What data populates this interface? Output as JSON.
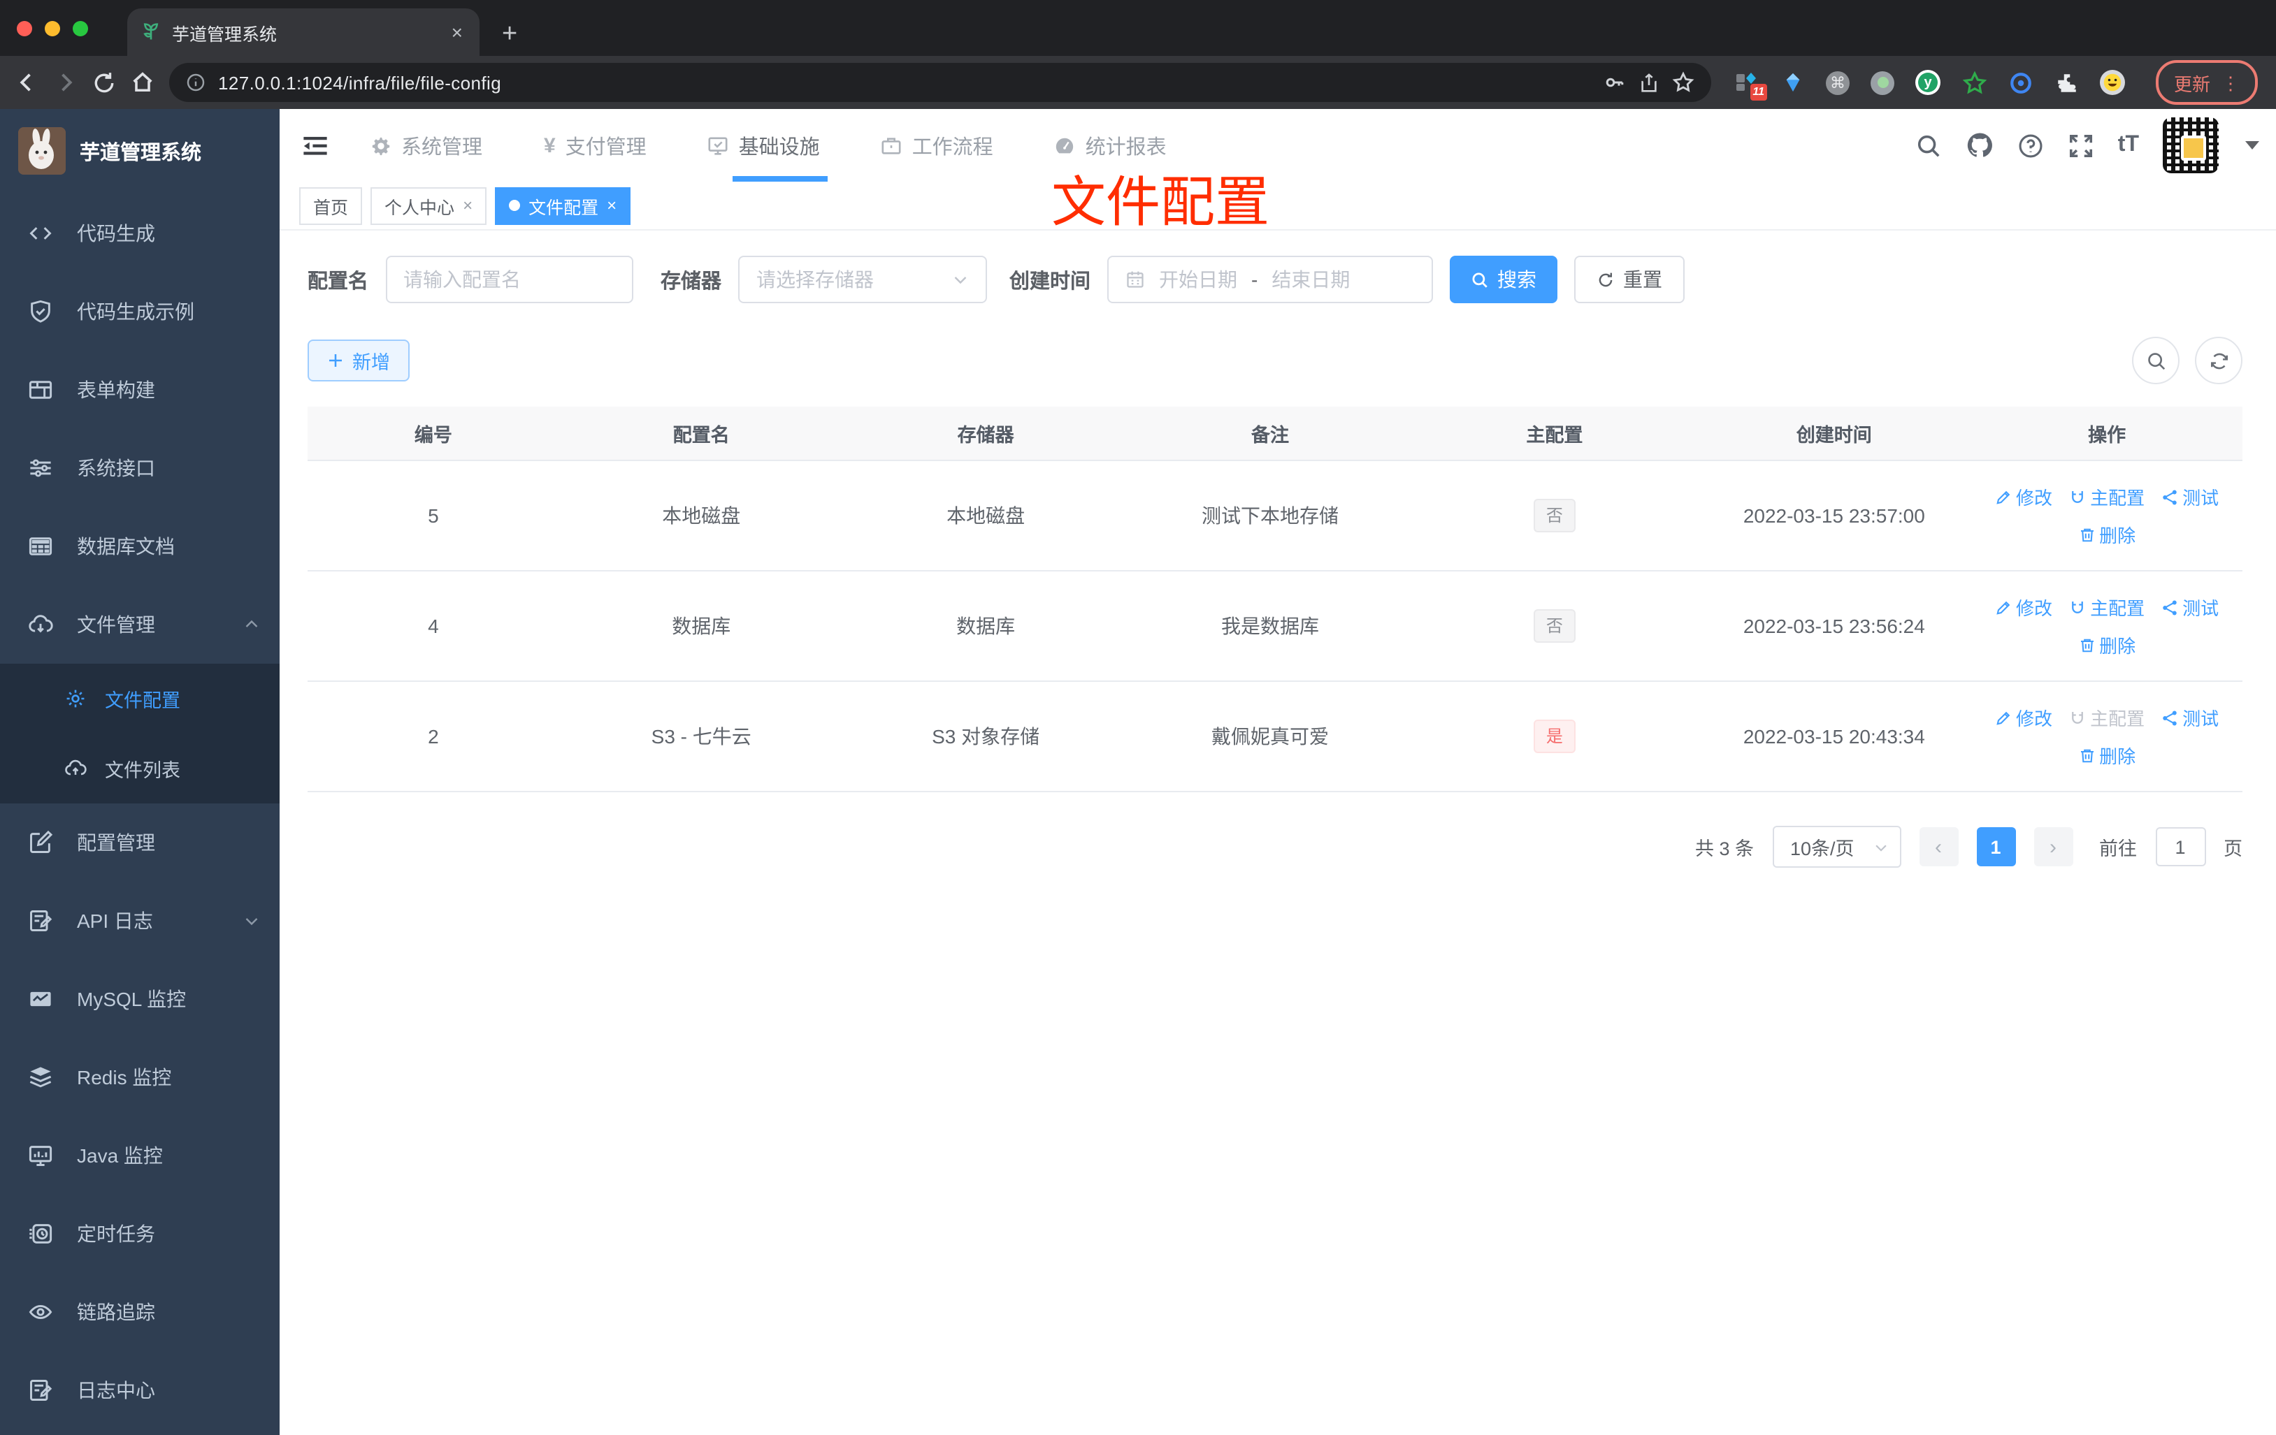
{
  "colors": {
    "accent": "#409eff",
    "danger": "#f56c6c",
    "annotation": "#ff2d00",
    "sidebar_bg": "#2f3e52",
    "sidebar_submenu_bg": "#222e3e"
  },
  "browser": {
    "tab_title": "芋道管理系统",
    "tab_close": "×",
    "new_tab": "+",
    "url": "127.0.0.1:1024/infra/file/file-config",
    "extension_badge": "11",
    "extension_y": "y",
    "extension_cmd": "⌘",
    "update_label": "更新",
    "menu_dots": "⋮"
  },
  "sidebar": {
    "logo_title": "芋道管理系统",
    "items": [
      {
        "label": "代码生成"
      },
      {
        "label": "代码生成示例"
      },
      {
        "label": "表单构建"
      },
      {
        "label": "系统接口"
      },
      {
        "label": "数据库文档"
      },
      {
        "label": "文件管理"
      }
    ],
    "file_submenu": [
      {
        "label": "文件配置"
      },
      {
        "label": "文件列表"
      }
    ],
    "items_lower": [
      {
        "label": "配置管理"
      },
      {
        "label": "API 日志"
      },
      {
        "label": "MySQL 监控"
      },
      {
        "label": "Redis 监控"
      },
      {
        "label": "Java 监控"
      },
      {
        "label": "定时任务"
      },
      {
        "label": "链路追踪"
      },
      {
        "label": "日志中心"
      }
    ]
  },
  "topnav": {
    "items": [
      {
        "label": "系统管理"
      },
      {
        "label": "支付管理"
      },
      {
        "label": "基础设施"
      },
      {
        "label": "工作流程"
      },
      {
        "label": "统计报表"
      }
    ],
    "yen": "¥",
    "font_size_icon": "tT"
  },
  "tags": {
    "close": "×",
    "items": [
      {
        "label": "首页"
      },
      {
        "label": "个人中心"
      },
      {
        "label": "文件配置"
      }
    ]
  },
  "annotation": {
    "text": "文件配置"
  },
  "filters": {
    "name_label": "配置名",
    "name_placeholder": "请输入配置名",
    "storage_label": "存储器",
    "storage_placeholder": "请选择存储器",
    "date_label": "创建时间",
    "date_start_placeholder": "开始日期",
    "date_separator": "-",
    "date_end_placeholder": "结束日期",
    "search_label": "搜索",
    "reset_label": "重置"
  },
  "toolbar": {
    "add_label": "新增"
  },
  "table": {
    "headers": [
      "编号",
      "配置名",
      "存储器",
      "备注",
      "主配置",
      "创建时间",
      "操作"
    ],
    "action_labels": {
      "edit": "修改",
      "primary": "主配置",
      "test": "测试",
      "delete": "删除"
    },
    "rows": [
      {
        "id": "5",
        "name": "本地磁盘",
        "storage": "本地磁盘",
        "remark": "测试下本地存储",
        "primary": "否",
        "created": "2022-03-15 23:57:00"
      },
      {
        "id": "4",
        "name": "数据库",
        "storage": "数据库",
        "remark": "我是数据库",
        "primary": "否",
        "created": "2022-03-15 23:56:24"
      },
      {
        "id": "2",
        "name": "S3 - 七牛云",
        "storage": "S3 对象存储",
        "remark": "戴佩妮真可爱",
        "primary": "是",
        "created": "2022-03-15 20:43:34"
      }
    ]
  },
  "pagination": {
    "total": "共 3 条",
    "page_size": "10条/页",
    "prev": "‹",
    "next": "›",
    "current": "1",
    "goto_label": "前往",
    "goto_value": "1",
    "page_unit": "页"
  }
}
